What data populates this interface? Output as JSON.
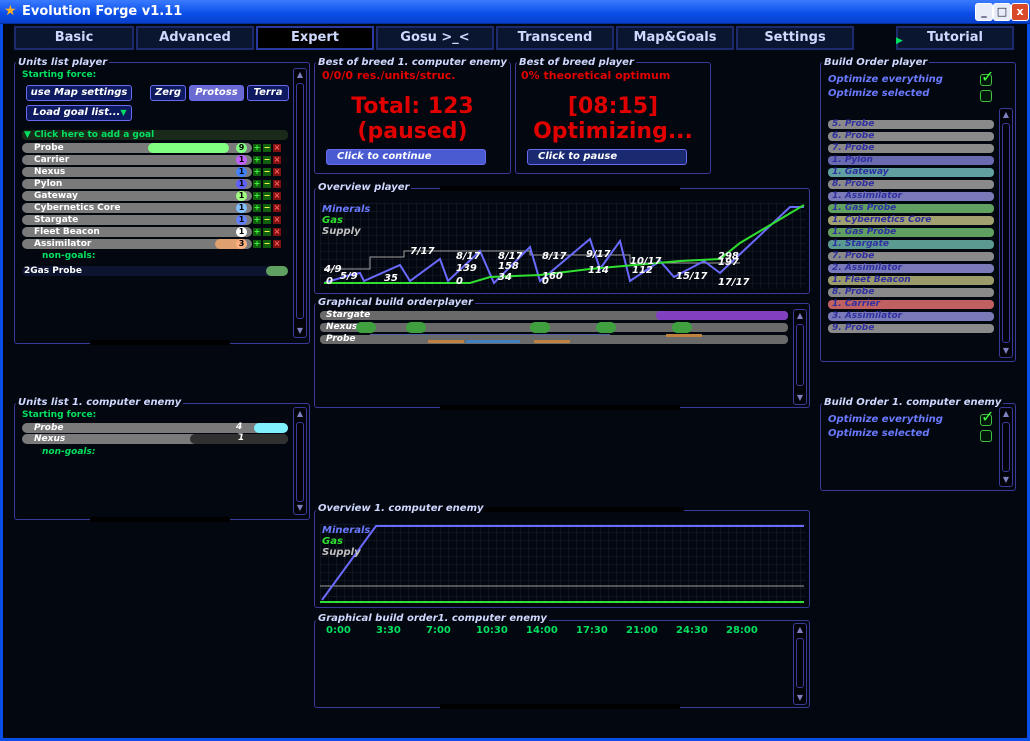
{
  "window": {
    "title": "Evolution Forge v1.11",
    "btn_min": "_",
    "btn_max": "□",
    "btn_close": "x",
    "app_icon": "star-icon"
  },
  "tabs": [
    {
      "label": "Basic"
    },
    {
      "label": "Advanced"
    },
    {
      "label": "Expert",
      "active": true
    },
    {
      "label": "Gosu >_<"
    },
    {
      "label": "Transcend"
    },
    {
      "label": "Map&Goals"
    },
    {
      "label": "Settings"
    },
    {
      "label": "Tutorial"
    }
  ],
  "units_player": {
    "title": "Units list player",
    "starting_force": "Starting force:",
    "use_map": "use Map settings",
    "races": [
      "Zerg",
      "Protoss",
      "Terra"
    ],
    "selected_race": "Protoss",
    "load_goal": "Load goal list...",
    "add_goal": "Click here to add a goal",
    "units": [
      {
        "name": "Probe",
        "count": "9",
        "fill": 0.78,
        "color": "#80ff80"
      },
      {
        "name": "Carrier",
        "count": "1",
        "color": "#c060ff"
      },
      {
        "name": "Nexus",
        "count": "1",
        "color": "#4080ff"
      },
      {
        "name": "Pylon",
        "count": "1",
        "color": "#6060ff"
      },
      {
        "name": "Gateway",
        "count": "1",
        "color": "#a0ff80"
      },
      {
        "name": "Cybernetics Core",
        "count": "1",
        "color": "#80c0ff"
      },
      {
        "name": "Stargate",
        "count": "1",
        "color": "#6080ff"
      },
      {
        "name": "Fleet Beacon",
        "count": "1",
        "color": "#ffffff"
      },
      {
        "name": "Assimilator",
        "count": "3",
        "color": "#ffb080"
      }
    ],
    "non_goals": "non-goals:",
    "extra": "2Gas Probe"
  },
  "units_enemy": {
    "title": "Units list 1. computer enemy",
    "starting_force": "Starting force:",
    "units": [
      {
        "name": "Probe",
        "count": "4"
      },
      {
        "name": "Nexus",
        "count": "1"
      }
    ],
    "non_goals": "non-goals:"
  },
  "breed_enemy": {
    "title": "Best of breed 1. computer enemy",
    "subtitle": "0/0/0 res./units/struc.",
    "line1": "Total: 123",
    "line2": "(paused)",
    "button": "Click to continue"
  },
  "breed_player": {
    "title": "Best of breed player",
    "subtitle": "0% theoretical optimum",
    "line1": "[08:15]",
    "line2": "Optimizing...",
    "button": "Click to pause"
  },
  "overview_player": {
    "title": "Overview player",
    "legend": [
      "Minerals",
      "Gas",
      "Supply"
    ],
    "supply_labels": [
      "4/9",
      "5/9",
      "7/17",
      "8/17",
      "8/17",
      "8/17",
      "9/17",
      "10/17",
      "15/17",
      "17/17"
    ],
    "value_labels": [
      "0",
      "35",
      "0",
      "139",
      "158",
      "34",
      "160",
      "0",
      "114",
      "112",
      "298",
      "197"
    ]
  },
  "gbo_player": {
    "title": "Graphical build orderplayer",
    "rows": [
      "Stargate",
      "Nexus",
      "Probe"
    ]
  },
  "build_order_player": {
    "title": "Build Order player",
    "opt_all": "Optimize everything",
    "opt_sel": "Optimize selected",
    "items": [
      {
        "label": "5. Probe",
        "color": "#8a8a8a"
      },
      {
        "label": "6. Probe",
        "color": "#8a8a8a"
      },
      {
        "label": "7. Probe",
        "color": "#8a8a8a"
      },
      {
        "label": "1. Pylon",
        "color": "#6a6ab0"
      },
      {
        "label": "1. Gateway",
        "color": "#60a0a0"
      },
      {
        "label": "8. Probe",
        "color": "#8a8a8a"
      },
      {
        "label": "1. Assimilator",
        "color": "#7a7ab8"
      },
      {
        "label": "1. Gas Probe",
        "color": "#60a060"
      },
      {
        "label": "1. Cybernetics Core",
        "color": "#a0a070"
      },
      {
        "label": "1. Gas Probe",
        "color": "#60a060"
      },
      {
        "label": "1. Stargate",
        "color": "#5a9a90"
      },
      {
        "label": "7. Probe",
        "color": "#8a8a8a"
      },
      {
        "label": "2. Assimilator",
        "color": "#7a7ab8"
      },
      {
        "label": "1. Fleet Beacon",
        "color": "#9a9a6a"
      },
      {
        "label": "8. Probe",
        "color": "#8a8a8a"
      },
      {
        "label": "1. Carrier",
        "color": "#c06060"
      },
      {
        "label": "3. Assimilator",
        "color": "#7a7ab8"
      },
      {
        "label": "9. Probe",
        "color": "#8a8a8a"
      }
    ]
  },
  "build_order_enemy": {
    "title": "Build Order 1. computer enemy",
    "opt_all": "Optimize everything",
    "opt_sel": "Optimize selected"
  },
  "overview_enemy": {
    "title": "Overview 1. computer enemy",
    "legend": [
      "Minerals",
      "Gas",
      "Supply"
    ]
  },
  "gbo_enemy": {
    "title": "Graphical build order1. computer enemy",
    "times": [
      "0:00",
      "3:30",
      "7:00",
      "10:30",
      "14:00",
      "17:30",
      "21:00",
      "24:30",
      "28:00"
    ]
  },
  "colors": {
    "minerals": "#6a6aff",
    "gas": "#30e030",
    "supply": "#c0c0c0",
    "accent_red": "#e00000"
  }
}
